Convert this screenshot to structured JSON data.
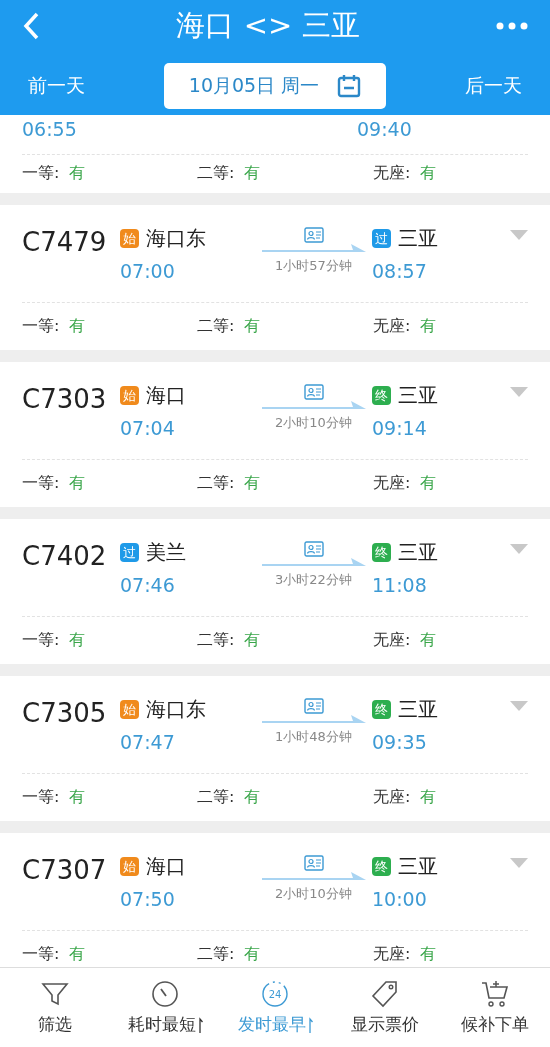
{
  "header": {
    "title": "海口 <> 三亚",
    "prev_day": "前一天",
    "date": "10月05日 周一",
    "next_day": "后一天"
  },
  "partial_train": {
    "departure_time": "06:55",
    "arrival_time": "09:40",
    "seats": [
      {
        "label": "一等:",
        "value": "有"
      },
      {
        "label": "二等:",
        "value": "有"
      },
      {
        "label": "无座:",
        "value": "有"
      }
    ]
  },
  "trains": [
    {
      "number": "C7479",
      "from": {
        "kind": "start",
        "badge": "始",
        "station": "海口东",
        "time": "07:00"
      },
      "duration": "1小时57分钟",
      "to": {
        "kind": "pass",
        "badge": "过",
        "station": "三亚",
        "time": "08:57"
      },
      "seats": [
        {
          "label": "一等:",
          "value": "有"
        },
        {
          "label": "二等:",
          "value": "有"
        },
        {
          "label": "无座:",
          "value": "有"
        }
      ]
    },
    {
      "number": "C7303",
      "from": {
        "kind": "start",
        "badge": "始",
        "station": "海口",
        "time": "07:04"
      },
      "duration": "2小时10分钟",
      "to": {
        "kind": "end",
        "badge": "终",
        "station": "三亚",
        "time": "09:14"
      },
      "seats": [
        {
          "label": "一等:",
          "value": "有"
        },
        {
          "label": "二等:",
          "value": "有"
        },
        {
          "label": "无座:",
          "value": "有"
        }
      ]
    },
    {
      "number": "C7402",
      "from": {
        "kind": "pass",
        "badge": "过",
        "station": "美兰",
        "time": "07:46"
      },
      "duration": "3小时22分钟",
      "to": {
        "kind": "end",
        "badge": "终",
        "station": "三亚",
        "time": "11:08"
      },
      "seats": [
        {
          "label": "一等:",
          "value": "有"
        },
        {
          "label": "二等:",
          "value": "有"
        },
        {
          "label": "无座:",
          "value": "有"
        }
      ]
    },
    {
      "number": "C7305",
      "from": {
        "kind": "start",
        "badge": "始",
        "station": "海口东",
        "time": "07:47"
      },
      "duration": "1小时48分钟",
      "to": {
        "kind": "end",
        "badge": "终",
        "station": "三亚",
        "time": "09:35"
      },
      "seats": [
        {
          "label": "一等:",
          "value": "有"
        },
        {
          "label": "二等:",
          "value": "有"
        },
        {
          "label": "无座:",
          "value": "有"
        }
      ]
    },
    {
      "number": "C7307",
      "from": {
        "kind": "start",
        "badge": "始",
        "station": "海口",
        "time": "07:50"
      },
      "duration": "2小时10分钟",
      "to": {
        "kind": "end",
        "badge": "终",
        "station": "三亚",
        "time": "10:00"
      },
      "seats": [
        {
          "label": "一等:",
          "value": "有"
        },
        {
          "label": "二等:",
          "value": "有"
        },
        {
          "label": "无座:",
          "value": "有"
        }
      ]
    }
  ],
  "bottom_bar": [
    {
      "kind": "filter",
      "label": "筛选",
      "selected": false
    },
    {
      "kind": "duration",
      "label": "耗时最短",
      "selected": false
    },
    {
      "kind": "departure",
      "label": "发时最早",
      "icon_text": "24",
      "selected": true
    },
    {
      "kind": "price",
      "label": "显示票价",
      "selected": false
    },
    {
      "kind": "waitlist",
      "label": "候补下单",
      "selected": false
    }
  ]
}
